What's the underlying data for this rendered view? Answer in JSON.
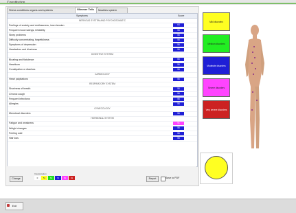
{
  "app": {
    "title": "Constitution"
  },
  "tabs": [
    {
      "label": "Stress conditions organs and systems"
    },
    {
      "label": "Glimmer Tells"
    },
    {
      "label": "Muskles system"
    }
  ],
  "table": {
    "headers": [
      "Symptoms",
      "Score"
    ],
    "rows": [
      {
        "q": "NERVOUS SYSTEM AND PSYCHOSOMATIC",
        "score": "",
        "section": true
      },
      {
        "q": "Feelings of anxiety and restlessness, inner tension",
        "score": "64"
      },
      {
        "q": "Frequent mood swings, irritability",
        "score": "56"
      },
      {
        "q": "Sleep problems",
        "score": "56"
      },
      {
        "q": "Difficulty concentrating, forgetfulness",
        "score": "56"
      },
      {
        "q": "Symptoms of depression",
        "score": "56"
      },
      {
        "q": "Headaches and dizziness",
        "score": "56"
      },
      {
        "q": "DIGESTIVE SYSTEM",
        "score": "",
        "section": true
      },
      {
        "q": "Bloating and flatulence",
        "score": "66"
      },
      {
        "q": "Heartburn",
        "score": "56"
      },
      {
        "q": "Constipation or diarrhea",
        "score": "56"
      },
      {
        "q": "CARDIOLOGY",
        "score": "",
        "section": true
      },
      {
        "q": "Heart palpitations",
        "score": "56"
      },
      {
        "q": "RESPIRATORY SYSTEM",
        "score": "",
        "section": true
      },
      {
        "q": "Shortness of breath",
        "score": "56"
      },
      {
        "q": "Chronic cough",
        "score": "56"
      },
      {
        "q": "Frequent infections",
        "score": "56"
      },
      {
        "q": "Allergies",
        "score": "56"
      },
      {
        "q": "GYNECOLOGY",
        "score": "",
        "section": true
      },
      {
        "q": "Menstrual disorders",
        "score": "56"
      },
      {
        "q": "HORMONAL SYSTEM",
        "score": "",
        "section": true
      },
      {
        "q": "Fatigue and weakness",
        "score": "91",
        "pink": true
      },
      {
        "q": "Weight changes",
        "score": "56"
      },
      {
        "q": "Feeling cold",
        "score": "56"
      },
      {
        "q": "Hair loss",
        "score": "56"
      }
    ]
  },
  "bottom": {
    "change_label": "Change",
    "legend_title": "Interpretation",
    "legend": [
      {
        "label": "0",
        "color": "#ffffff"
      },
      {
        "label": "51",
        "color": "#ffff22"
      },
      {
        "label": "61",
        "color": "#22dd22"
      },
      {
        "label": "71",
        "color": "#1f1fd6"
      },
      {
        "label": "81",
        "color": "#ff44ff"
      },
      {
        "label": "91",
        "color": "#cc2222"
      }
    ],
    "report_label": "Report",
    "pdf_label": "Save to PDF"
  },
  "categories": [
    {
      "label": "Mild disorders",
      "color": "#ffff22"
    },
    {
      "label": "Medium disorders",
      "color": "#22ee22"
    },
    {
      "label": "Moderate disorders",
      "color": "#1f1fd6"
    },
    {
      "label": "Severe disorders",
      "color": "#ff44ff"
    },
    {
      "label": "Very severe disorders",
      "color": "#cc2222"
    }
  ],
  "taskbar": {
    "exit_label": "Exit"
  }
}
